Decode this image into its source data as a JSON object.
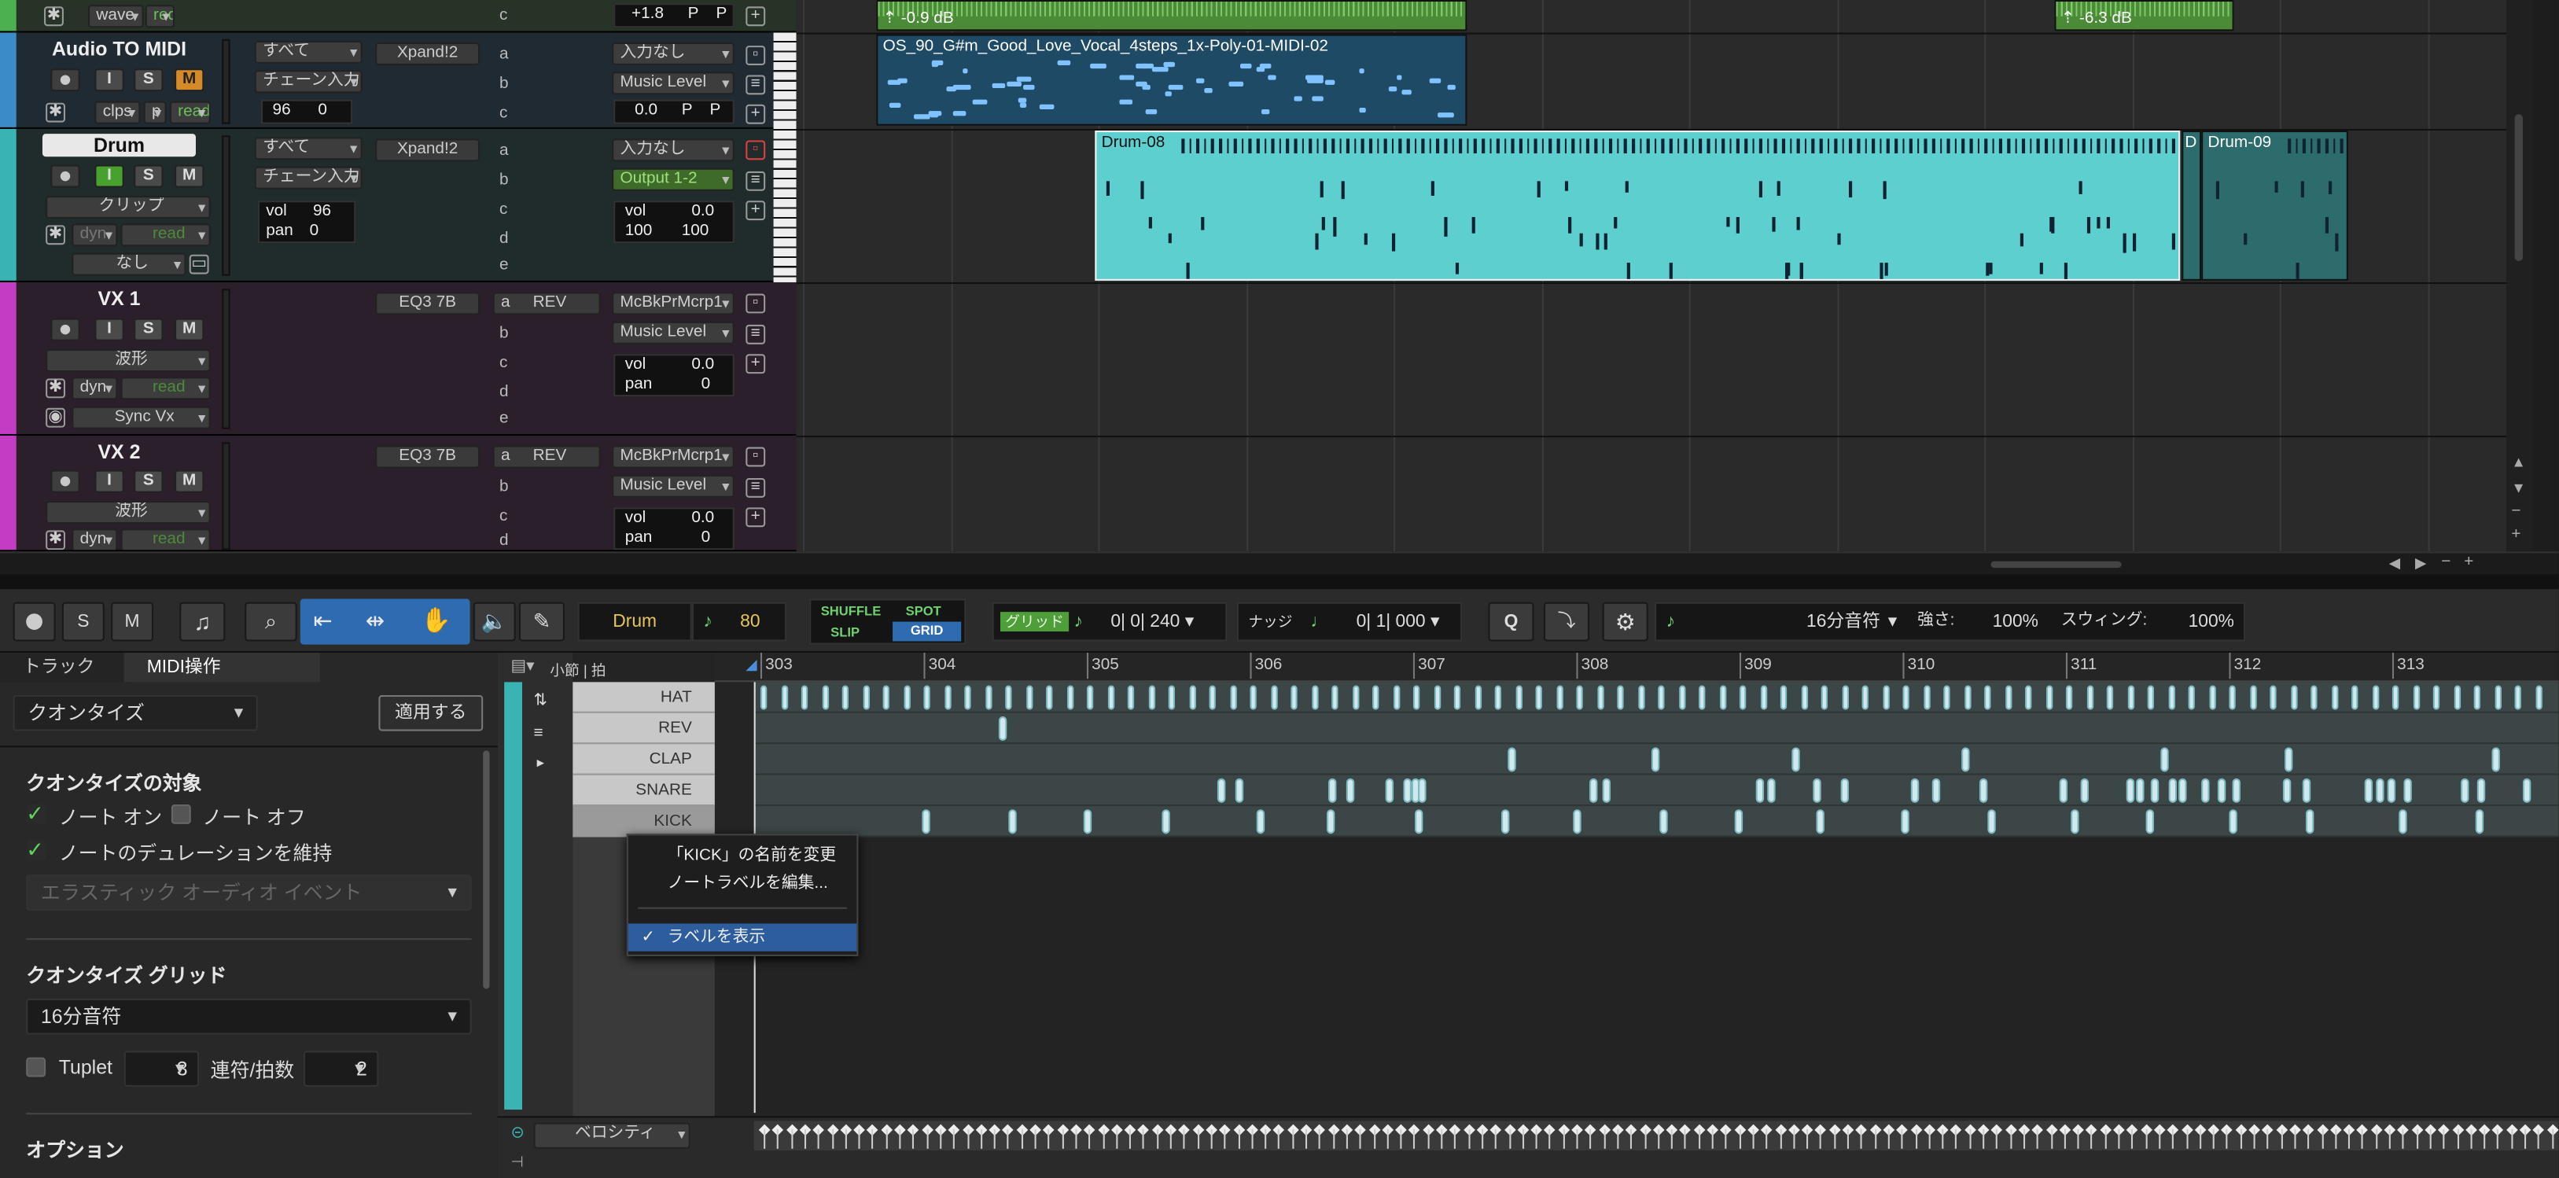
{
  "tracks": {
    "wave_top": {
      "mode_label": "wave",
      "rec_label": "red",
      "send": "c",
      "vol": "+1.8",
      "p1": "P",
      "p2": "P"
    },
    "audio_to_midi": {
      "name": "Audio TO MIDI",
      "input_sel": "すべて",
      "chain_input": "チェーン入力",
      "plugin": "Xpand!2",
      "sends": [
        "a",
        "b",
        "c"
      ],
      "output_in": "入力なし",
      "output_music": "Music Level",
      "vol": "0.0",
      "p1": "P",
      "p2": "P",
      "view": "clps",
      "p_label": "p",
      "automation": "read",
      "velocity": "96",
      "offset": "0",
      "mute": "M",
      "solo": "S",
      "input": "I"
    },
    "drum": {
      "name": "Drum",
      "input_sel": "すべて",
      "chain_input": "チェーン入力",
      "plugin": "Xpand!2",
      "sends": [
        "a",
        "b",
        "c",
        "d",
        "e"
      ],
      "output_in": "入力なし",
      "output_main": "Output 1-2",
      "view": "クリップ",
      "dyn": "dyn",
      "automation": "read",
      "none": "なし",
      "vol_label": "vol",
      "vol_value": "96",
      "pan_label": "pan",
      "pan_value": "0",
      "lcd_vol_label": "vol",
      "lcd_vol": "0.0",
      "lcd_pan_l": "100",
      "lcd_pan_r": "100"
    },
    "vx1": {
      "name": "VX 1",
      "plugin1": "EQ3 7B",
      "send_a": "a",
      "plugin2": "REV",
      "output1": "McBkPrMcrp1",
      "output_music": "Music Level",
      "sends": [
        "b",
        "c",
        "d",
        "e"
      ],
      "view": "波形",
      "dyn": "dyn",
      "automation": "read",
      "sync": "Sync Vx",
      "vol_label": "vol",
      "vol": "0.0",
      "pan_label": "pan",
      "pan": "0"
    },
    "vx2": {
      "name": "VX 2",
      "plugin1": "EQ3 7B",
      "send_a": "a",
      "plugin2": "REV",
      "output1": "McBkPrMcrp1",
      "output_music": "Music Level",
      "sends": [
        "b",
        "c",
        "d"
      ],
      "view": "波形",
      "dyn": "dyn",
      "automation": "read",
      "vol_label": "vol",
      "vol": "0.0",
      "pan_label": "pan",
      "pan": "0"
    }
  },
  "clips": {
    "wave_left_gain": "-0.9 dB",
    "wave_right_gain": "-6.3 dB",
    "midi_clip": "OS_90_G#m_Good_Love_Vocal_4steps_1x-Poly-01-MIDI-02",
    "drum08": "Drum-08",
    "drum09": "Drum-09",
    "d_label": "D"
  },
  "toolbar": {
    "track_sel": "Drum",
    "note_value": "80",
    "modes": [
      "SHUFFLE",
      "SPOT",
      "SLIP",
      "GRID"
    ],
    "grid_label": "グリッド",
    "grid_value": "0| 0| 240",
    "nudge_label": "ナッジ",
    "nudge_value": "0| 1| 000",
    "quant_value": "16分音符",
    "strength_label": "強さ:",
    "strength_value": "100%",
    "swing_label": "スウィング:",
    "swing_value": "100%"
  },
  "leftpanel": {
    "tab_track": "トラック",
    "tab_midi": "MIDI操作",
    "operation": "クオンタイズ",
    "apply": "適用する",
    "target_heading": "クオンタイズの対象",
    "note_on": "ノート オン",
    "note_off": "ノート オフ",
    "keep_duration": "ノートのデュレーションを維持",
    "elastic": "エラスティック オーディオ イベント",
    "grid_heading": "クオンタイズ グリッド",
    "grid_value": "16分音符",
    "tuplet": "Tuplet",
    "tuplet_value": "3",
    "tuplet_per_label": "連符/拍数",
    "tuplet_per_value": "2",
    "options_heading": "オプション"
  },
  "midi_editor": {
    "ruler_label": "小節 | 拍",
    "bars": [
      "303",
      "304",
      "305",
      "306",
      "307",
      "308",
      "309",
      "310",
      "311",
      "312",
      "313"
    ],
    "lanes": [
      "HAT",
      "REV",
      "CLAP",
      "SNARE",
      "KICK"
    ],
    "velocity_label": "ベロシティ"
  },
  "context_menu": {
    "rename": "「KICK」の名前を変更",
    "edit_labels": "ノートラベルを編集...",
    "show_labels": "ラベルを表示",
    "check": "✓"
  },
  "colors": {
    "drum_clip": "#5ecfcf",
    "midi_clip": "#1e4a66",
    "wave_clip": "#4e8a3a",
    "vx_track": "#3a1f3a",
    "accent_blue": "#2f6bb0",
    "menu_highlight": "#2e5d9e"
  }
}
